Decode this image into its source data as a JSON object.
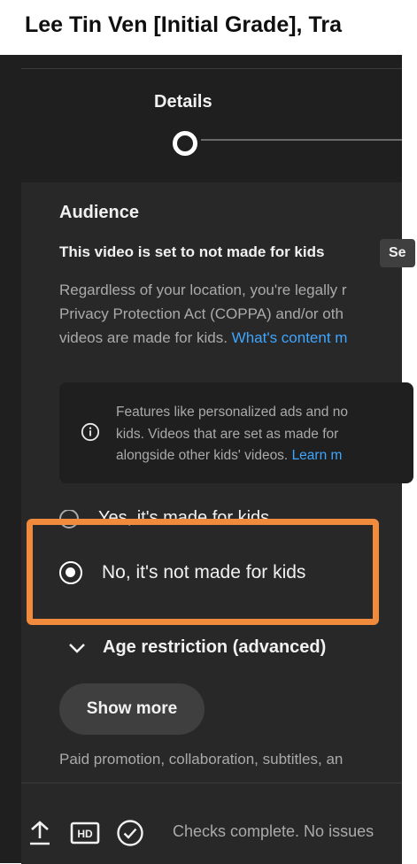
{
  "header": {
    "title": "Lee Tin Ven [Initial Grade], Tra"
  },
  "stepper": {
    "current_step": "Details"
  },
  "audience": {
    "heading": "Audience",
    "status": "This video is set to not made for kids",
    "status_chip": "Se",
    "description_line1": "Regardless of your location, you're legally r",
    "description_line2": "Privacy Protection Act (COPPA) and/or oth",
    "description_line3": "videos are made for kids.",
    "description_link": "What's content m",
    "notice_line1": "Features like personalized ads and no",
    "notice_line2": "kids. Videos that are set as made for",
    "notice_line3": "alongside other kids' videos.",
    "notice_link": "Learn m",
    "options": [
      {
        "label": "Yes, it's made for kids",
        "selected": false
      },
      {
        "label": "No, it's not made for kids",
        "selected": true
      }
    ]
  },
  "age_restriction": {
    "label": "Age restriction (advanced)"
  },
  "show_more": {
    "label": "Show more",
    "description": "Paid promotion, collaboration, subtitles, an"
  },
  "footer": {
    "status": "Checks complete. No issues"
  },
  "colors": {
    "highlight": "#f08a3c",
    "link": "#3ea6ff",
    "panel": "#282828"
  }
}
